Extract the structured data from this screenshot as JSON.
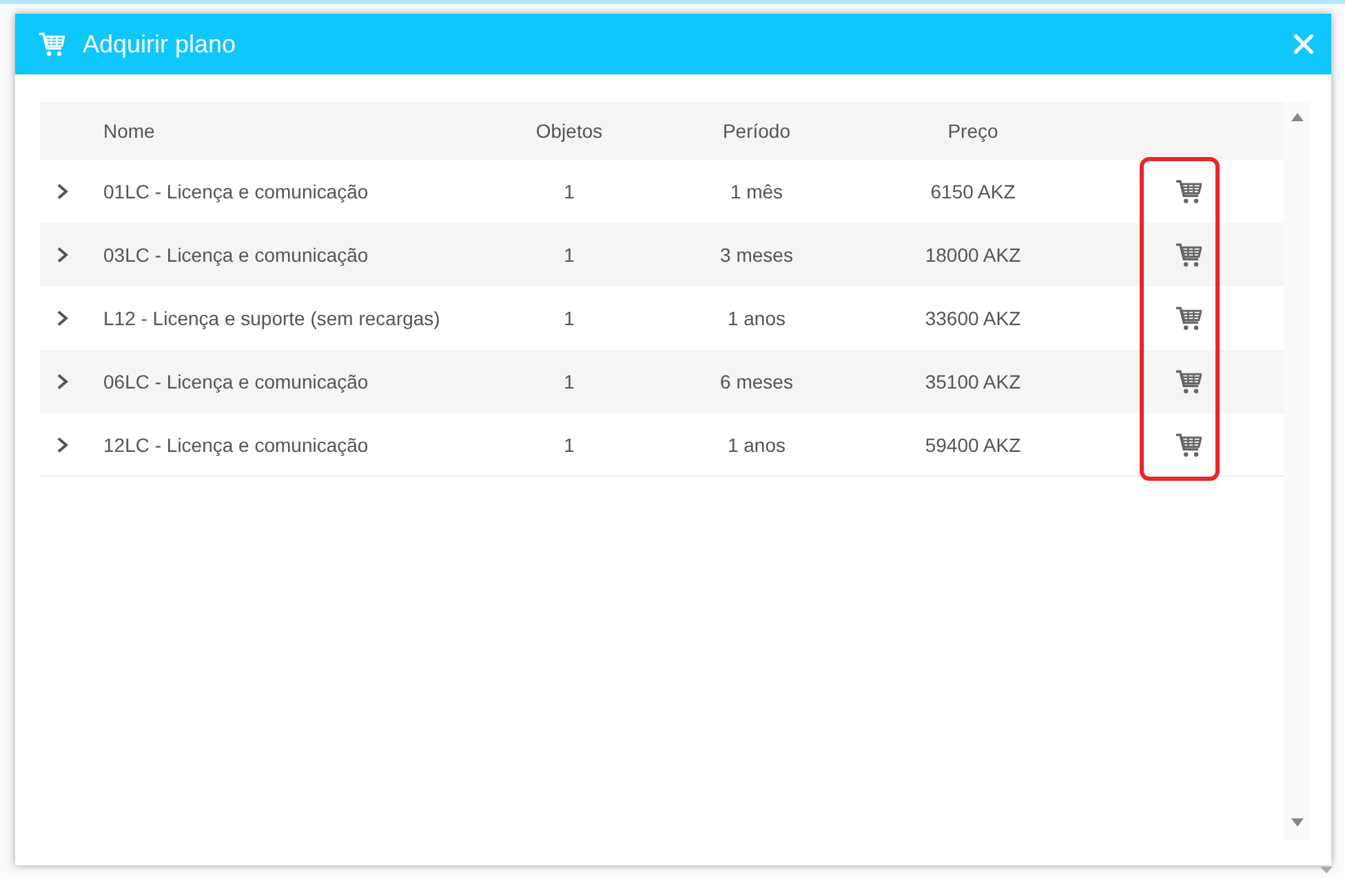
{
  "window": {
    "title": "Adquirir plano"
  },
  "table": {
    "columns": [
      "Nome",
      "Objetos",
      "Período",
      "Preço"
    ],
    "rows": [
      {
        "name": "01LC - Licença e comunicação",
        "objects": "1",
        "period": "1 mês",
        "price": "6150 AKZ",
        "expanded": false
      },
      {
        "name": "03LC - Licença e comunicação",
        "objects": "1",
        "period": "3 meses",
        "price": "18000 AKZ",
        "expanded": false
      },
      {
        "name": "L12 - Licença e suporte (sem recargas)",
        "objects": "1",
        "period": "1 anos",
        "price": "33600 AKZ",
        "expanded": false
      },
      {
        "name": "06LC - Licença e comunicação",
        "objects": "1",
        "period": "6 meses",
        "price": "35100 AKZ",
        "expanded": false
      },
      {
        "name": "12LC - Licença e comunicação",
        "objects": "1",
        "period": "1 anos",
        "price": "59400 AKZ",
        "expanded": false
      }
    ],
    "buy_column_highlighted": true
  }
}
